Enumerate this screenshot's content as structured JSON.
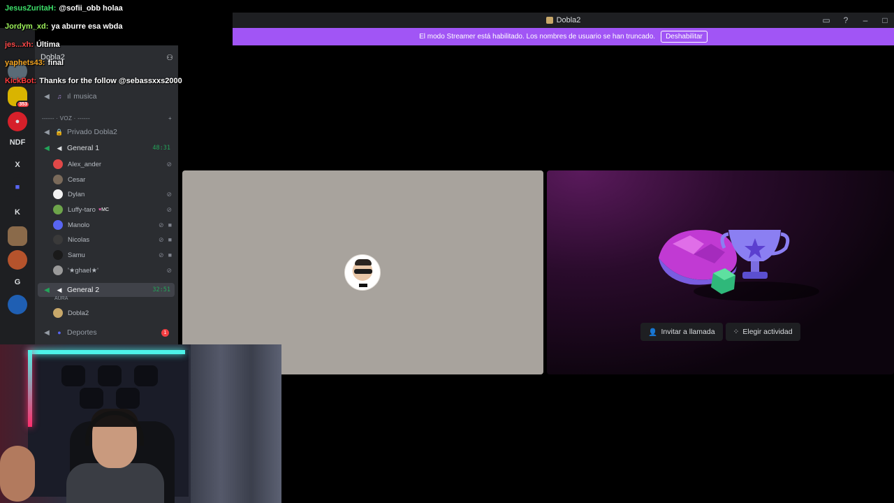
{
  "window": {
    "title": "Dobla2"
  },
  "banner": {
    "text": "El modo Streamer está habilitado. Los nombres de usuario se han truncado.",
    "button": "Deshabilitar"
  },
  "server": {
    "name": "Dobla2"
  },
  "rail": {
    "badge": "353",
    "letters": [
      "NDF",
      "X",
      "K",
      "G"
    ]
  },
  "channels": {
    "music": "musica",
    "voice_category": "------ · VOZ · ------",
    "private": "Privado Dobla2",
    "general1": {
      "name": "General 1",
      "timer": "48:31"
    },
    "general2": {
      "name": "General 2",
      "timer": "32:51",
      "sub": "AURA"
    },
    "deportes": {
      "name": "Deportes",
      "mentions": "1"
    }
  },
  "general1_users": [
    {
      "name": "Alex_ander"
    },
    {
      "name": "Cesar"
    },
    {
      "name": "Dylan"
    },
    {
      "name": "Luffy-taro",
      "tag": "MC"
    },
    {
      "name": "Manolo"
    },
    {
      "name": "Nicolas"
    },
    {
      "name": "Samu"
    },
    {
      "name": "'★ghael★'"
    }
  ],
  "general2_users": [
    {
      "name": "Dobla2"
    }
  ],
  "activity": {
    "invite": "Invitar a llamada",
    "choose": "Elegir actividad"
  },
  "chat": [
    {
      "user": "JesusZuritaH:",
      "text": "@sofii_obb holaa",
      "color": "#3de06a"
    },
    {
      "user": "Jordym_xd:",
      "text": "ya aburre esa wbda",
      "color": "#9ef25b"
    },
    {
      "user": "jes...xh:",
      "text": "Última",
      "color": "#ff4b4b"
    },
    {
      "user": "yaphets43:",
      "text": "final",
      "color": "#f5a623"
    },
    {
      "user": "KickBot:",
      "text": "Thanks for the follow @sebassxxs2000",
      "color": "#ff3b3b"
    }
  ]
}
